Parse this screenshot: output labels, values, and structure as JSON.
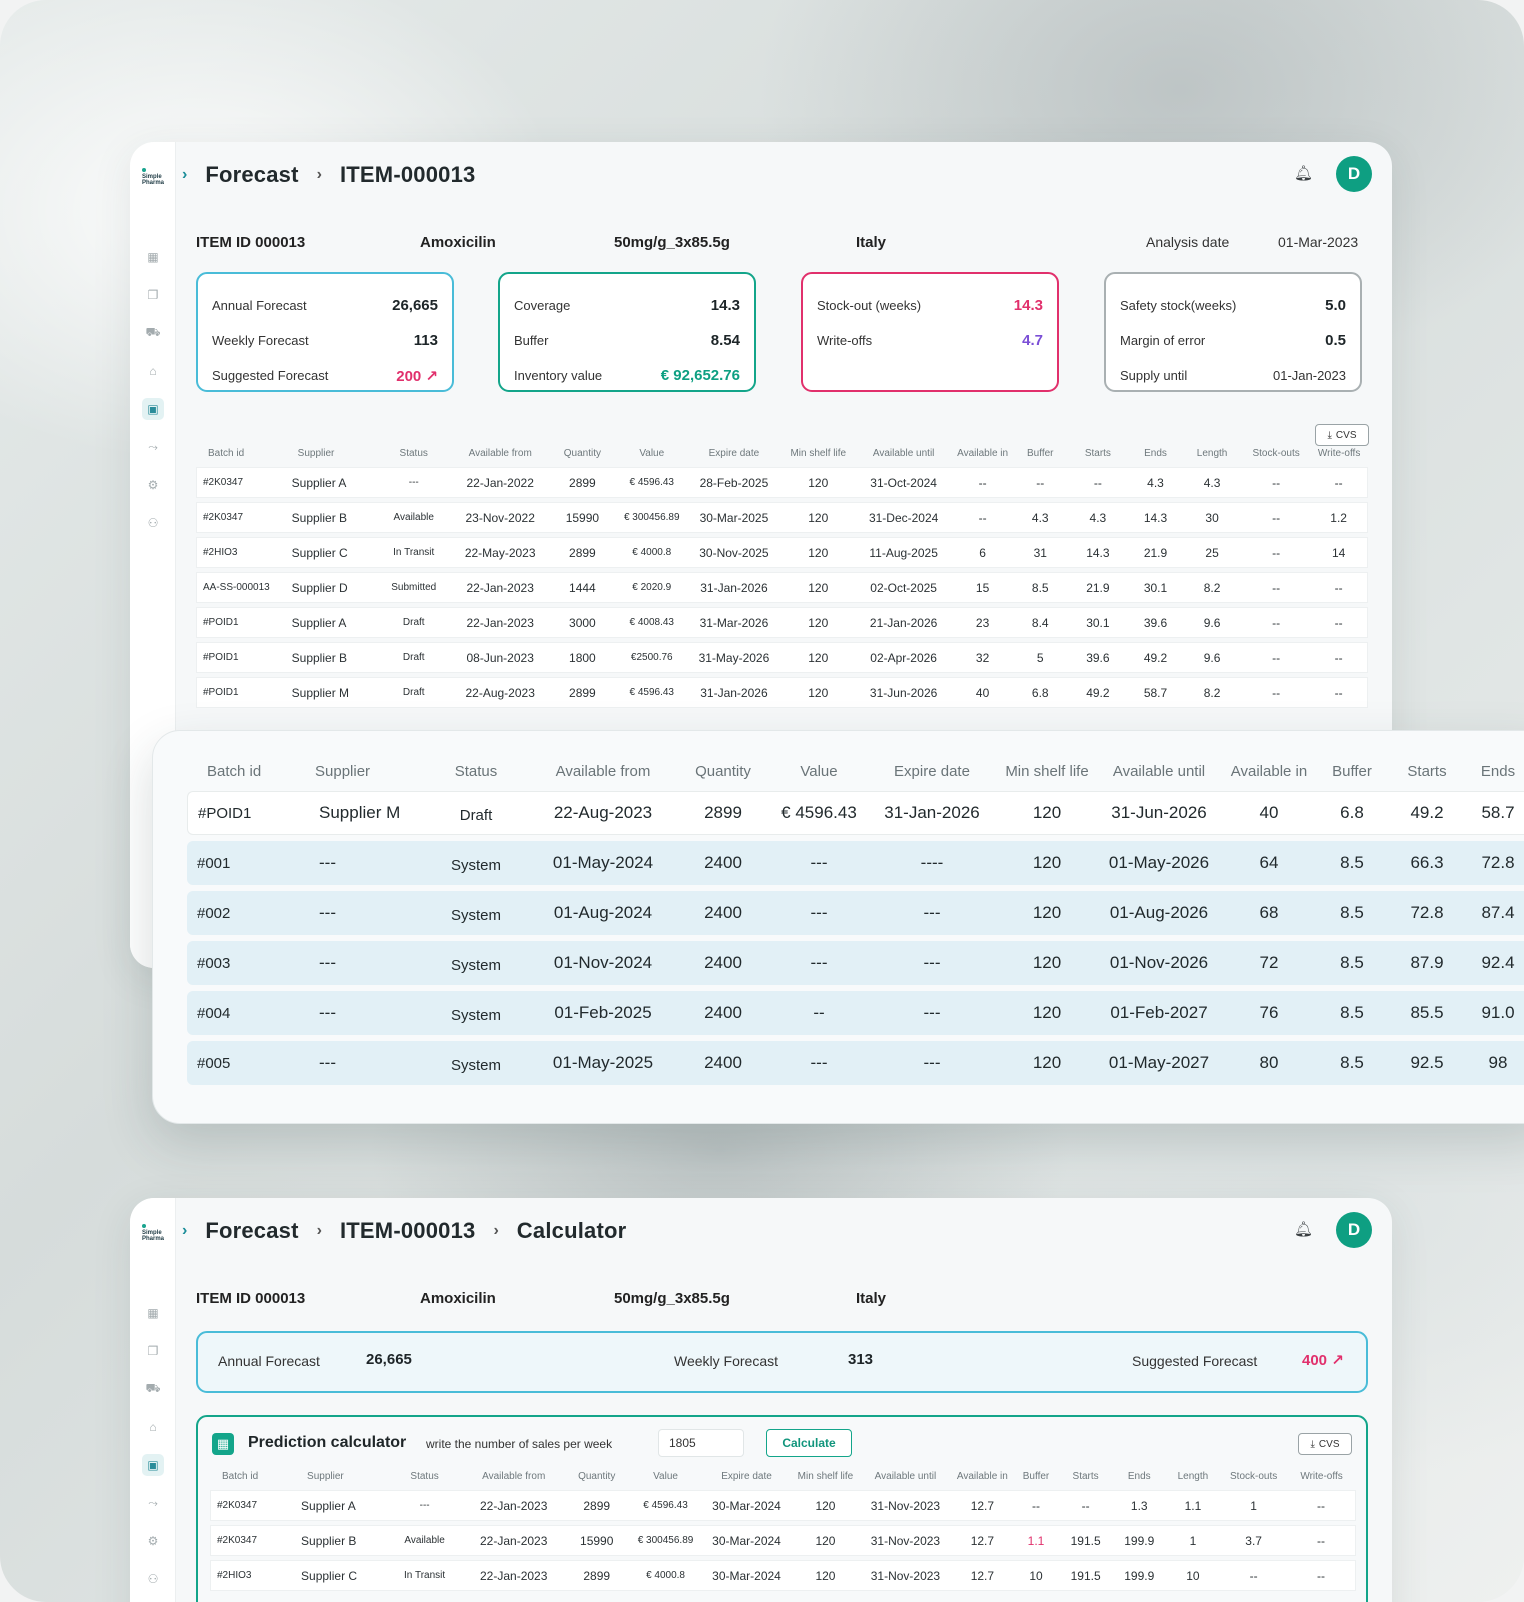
{
  "top": {
    "breadcrumbs": [
      "Forecast",
      "ITEM-000013"
    ],
    "avatar_initial": "D",
    "item": {
      "id": "ITEM ID 000013",
      "product": "Amoxicilin",
      "dosage": "50mg/g_3x85.5g",
      "country": "Italy",
      "analysis_label": "Analysis date",
      "analysis_date": "01-Mar-2023"
    },
    "cards": {
      "forecast": {
        "annual_label": "Annual Forecast",
        "annual_value": "26,665",
        "weekly_label": "Weekly Forecast",
        "weekly_value": "113",
        "suggested_label": "Suggested Forecast",
        "suggested_value": "200 ↗"
      },
      "coverage": {
        "coverage_label": "Coverage",
        "coverage_value": "14.3",
        "buffer_label": "Buffer",
        "buffer_value": "8.54",
        "inventory_label": "Inventory value",
        "inventory_value": "€ 92,652.76"
      },
      "stock": {
        "stockout_label": "Stock-out (weeks)",
        "stockout_value": "14.3",
        "writeoffs_label": "Write-offs",
        "writeoffs_value": "4.7"
      },
      "safety": {
        "safety_label": "Safety stock(weeks)",
        "safety_value": "5.0",
        "margin_label": "Margin of error",
        "margin_value": "0.5",
        "supply_label": "Supply until",
        "supply_value": "01-Jan-2023"
      }
    },
    "cvs_label": "CVS",
    "table": {
      "headers": [
        "Batch id",
        "Supplier",
        "Status",
        "Available from",
        "Quantity",
        "Value",
        "Expire date",
        "Min shelf life",
        "Available until",
        "Available in",
        "Buffer",
        "Starts",
        "Ends",
        "Length",
        "Stock-outs",
        "Write-offs"
      ],
      "rows": [
        [
          "#2K0347",
          "Supplier A",
          "---",
          "22-Jan-2022",
          "2899",
          "€ 4596.43",
          "28-Feb-2025",
          "120",
          "31-Oct-2024",
          "--",
          "--",
          "--",
          "4.3",
          "4.3",
          "--",
          "--"
        ],
        [
          "#2K0347",
          "Supplier B",
          "Available",
          "23-Nov-2022",
          "15990",
          "€ 300456.89",
          "30-Mar-2025",
          "120",
          "31-Dec-2024",
          "--",
          "4.3",
          "4.3",
          "14.3",
          "30",
          "--",
          "1.2"
        ],
        [
          "#2HIO3",
          "Supplier C",
          "In Transit",
          "22-May-2023",
          "2899",
          "€ 4000.8",
          "30-Nov-2025",
          "120",
          "11-Aug-2025",
          "6",
          "31",
          "14.3",
          "21.9",
          "25",
          "--",
          "14"
        ],
        [
          "AA-SS-000013",
          "Supplier D",
          "Submitted",
          "22-Jan-2023",
          "1444",
          "€ 2020.9",
          "31-Jan-2026",
          "120",
          "02-Oct-2025",
          "15",
          "8.5",
          "21.9",
          "30.1",
          "8.2",
          "--",
          "--"
        ],
        [
          "#POID1",
          "Supplier A",
          "Draft",
          "22-Jan-2023",
          "3000",
          "€ 4008.43",
          "31-Mar-2026",
          "120",
          "21-Jan-2026",
          "23",
          "8.4",
          "30.1",
          "39.6",
          "9.6",
          "--",
          "--"
        ],
        [
          "#POID1",
          "Supplier B",
          "Draft",
          "08-Jun-2023",
          "1800",
          "€2500.76",
          "31-May-2026",
          "120",
          "02-Apr-2026",
          "32",
          "5",
          "39.6",
          "49.2",
          "9.6",
          "--",
          "--"
        ],
        [
          "#POID1",
          "Supplier M",
          "Draft",
          "22-Aug-2023",
          "2899",
          "€ 4596.43",
          "31-Jan-2026",
          "120",
          "31-Jun-2026",
          "40",
          "6.8",
          "49.2",
          "58.7",
          "8.2",
          "--",
          "--"
        ]
      ]
    }
  },
  "zoom": {
    "headers": [
      "Batch id",
      "Supplier",
      "Status",
      "Available from",
      "Quantity",
      "Value",
      "Expire date",
      "Min shelf life",
      "Available until",
      "Available in",
      "Buffer",
      "Starts",
      "Ends"
    ],
    "rows": [
      [
        "#POID1",
        "Supplier M",
        "Draft",
        "22-Aug-2023",
        "2899",
        "€ 4596.43",
        "31-Jan-2026",
        "120",
        "31-Jun-2026",
        "40",
        "6.8",
        "49.2",
        "58.7"
      ],
      [
        "#001",
        "---",
        "System",
        "01-May-2024",
        "2400",
        "---",
        "----",
        "120",
        "01-May-2026",
        "64",
        "8.5",
        "66.3",
        "72.8"
      ],
      [
        "#002",
        "---",
        "System",
        "01-Aug-2024",
        "2400",
        "---",
        "---",
        "120",
        "01-Aug-2026",
        "68",
        "8.5",
        "72.8",
        "87.4"
      ],
      [
        "#003",
        "---",
        "System",
        "01-Nov-2024",
        "2400",
        "---",
        "---",
        "120",
        "01-Nov-2026",
        "72",
        "8.5",
        "87.9",
        "92.4"
      ],
      [
        "#004",
        "---",
        "System",
        "01-Feb-2025",
        "2400",
        "--",
        "---",
        "120",
        "01-Feb-2027",
        "76",
        "8.5",
        "85.5",
        "91.0"
      ],
      [
        "#005",
        "---",
        "System",
        "01-May-2025",
        "2400",
        "---",
        "---",
        "120",
        "01-May-2027",
        "80",
        "8.5",
        "92.5",
        "98"
      ]
    ]
  },
  "bottom": {
    "breadcrumbs": [
      "Forecast",
      "ITEM-000013",
      "Calculator"
    ],
    "avatar_initial": "D",
    "item": {
      "id": "ITEM ID 000013",
      "product": "Amoxicilin",
      "dosage": "50mg/g_3x85.5g",
      "country": "Italy"
    },
    "banner": {
      "annual_label": "Annual Forecast",
      "annual_value": "26,665",
      "weekly_label": "Weekly Forecast",
      "weekly_value": "313",
      "suggested_label": "Suggested Forecast",
      "suggested_value": "400 ↗"
    },
    "calculator": {
      "title": "Prediction calculator",
      "hint": "write the number of sales per week",
      "input_value": "1805",
      "button_label": "Calculate",
      "cvs_label": "CVS"
    },
    "table": {
      "headers": [
        "Batch id",
        "Supplier",
        "Status",
        "Available from",
        "Quantity",
        "Value",
        "Expire date",
        "Min shelf life",
        "Available until",
        "Available in",
        "Buffer",
        "Starts",
        "Ends",
        "Length",
        "Stock-outs",
        "Write-offs"
      ],
      "rows": [
        [
          "#2K0347",
          "Supplier A",
          "---",
          "22-Jan-2023",
          "2899",
          "€ 4596.43",
          "30-Mar-2024",
          "120",
          "31-Nov-2023",
          "12.7",
          "--",
          "--",
          "1.3",
          "1.1",
          "1",
          "--"
        ],
        [
          "#2K0347",
          "Supplier B",
          "Available",
          "22-Jan-2023",
          "15990",
          "€ 300456.89",
          "30-Mar-2024",
          "120",
          "31-Nov-2023",
          "12.7",
          "1.1",
          "191.5",
          "199.9",
          "1",
          "3.7",
          "--"
        ],
        [
          "#2HIO3",
          "Supplier C",
          "In Transit",
          "22-Jan-2023",
          "2899",
          "€ 4000.8",
          "30-Mar-2024",
          "120",
          "31-Nov-2023",
          "12.7",
          "10",
          "191.5",
          "199.9",
          "10",
          "--",
          "--"
        ]
      ]
    }
  },
  "colors": {
    "accent_teal": "#13a58a",
    "accent_pink": "#e1306c",
    "accent_blue": "#49bcd8",
    "accent_purple": "#7b4fd6"
  }
}
